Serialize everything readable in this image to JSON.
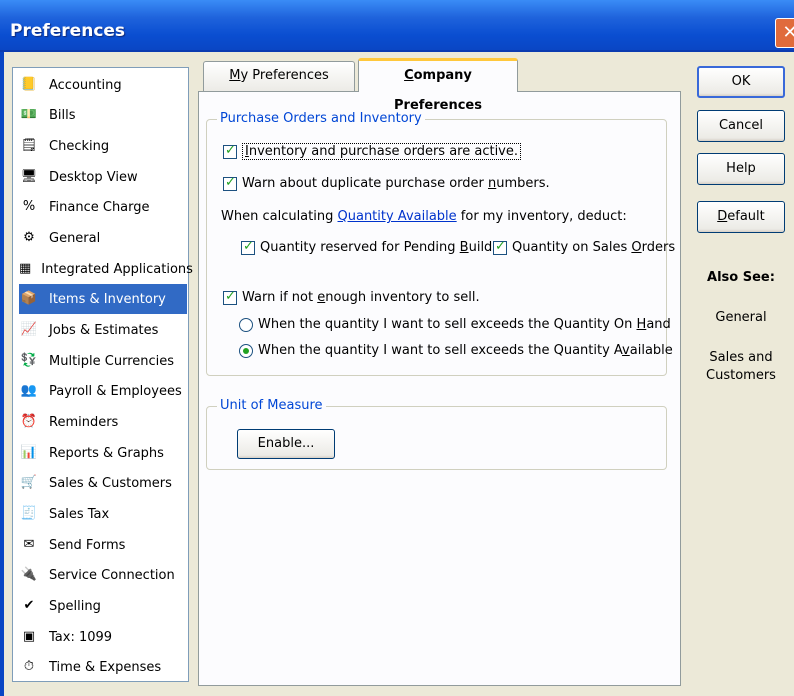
{
  "window": {
    "title": "Preferences",
    "close_symbol": "✕"
  },
  "categories": [
    {
      "label": "Accounting",
      "icon": "accounting-icon",
      "glyph": "📒"
    },
    {
      "label": "Bills",
      "icon": "bills-icon",
      "glyph": "💵"
    },
    {
      "label": "Checking",
      "icon": "checking-icon",
      "glyph": "🗒"
    },
    {
      "label": "Desktop View",
      "icon": "desktop-view-icon",
      "glyph": "🖥"
    },
    {
      "label": "Finance Charge",
      "icon": "finance-charge-icon",
      "glyph": "%"
    },
    {
      "label": "General",
      "icon": "general-icon",
      "glyph": "⚙"
    },
    {
      "label": "Integrated Applications",
      "icon": "integrated-applications-icon",
      "glyph": "▦"
    },
    {
      "label": "Items & Inventory",
      "icon": "items-inventory-icon",
      "glyph": "📦",
      "selected": true
    },
    {
      "label": "Jobs & Estimates",
      "icon": "jobs-estimates-icon",
      "glyph": "📈"
    },
    {
      "label": "Multiple Currencies",
      "icon": "multiple-currencies-icon",
      "glyph": "💱"
    },
    {
      "label": "Payroll & Employees",
      "icon": "payroll-employees-icon",
      "glyph": "👥"
    },
    {
      "label": "Reminders",
      "icon": "reminders-icon",
      "glyph": "⏰"
    },
    {
      "label": "Reports & Graphs",
      "icon": "reports-graphs-icon",
      "glyph": "📊"
    },
    {
      "label": "Sales & Customers",
      "icon": "sales-customers-icon",
      "glyph": "🛒"
    },
    {
      "label": "Sales Tax",
      "icon": "sales-tax-icon",
      "glyph": "🧾"
    },
    {
      "label": "Send Forms",
      "icon": "send-forms-icon",
      "glyph": "✉"
    },
    {
      "label": "Service Connection",
      "icon": "service-connection-icon",
      "glyph": "🔌"
    },
    {
      "label": "Spelling",
      "icon": "spelling-icon",
      "glyph": "✔"
    },
    {
      "label": "Tax: 1099",
      "icon": "tax-1099-icon",
      "glyph": "▣"
    },
    {
      "label": "Time & Expenses",
      "icon": "time-expenses-icon",
      "glyph": "⏱"
    }
  ],
  "tabs": {
    "my_label_first": "M",
    "my_label_rest": "y Preferences",
    "company_label_first": "C",
    "company_label_rest": "ompany Preferences"
  },
  "purchase": {
    "legend": "Purchase Orders and Inventory",
    "inventory_active": {
      "first": "I",
      "rest": "nventory and purchase orders are active.",
      "checked": true
    },
    "warn_duplicate": {
      "pre": "Warn about duplicate purchase order ",
      "acc": "n",
      "post": "umbers.",
      "checked": true
    },
    "calc_pre": "When calculating ",
    "calc_link": "Quantity Available",
    "calc_post": " for my inventory, deduct:",
    "pending_builds": {
      "pre": "Quantity reserved for Pending ",
      "acc": "B",
      "post": "uilds",
      "checked": true
    },
    "sales_orders": {
      "pre": "Quantity on Sales ",
      "acc": "O",
      "post": "rders",
      "checked": true
    },
    "warn_not_enough": {
      "pre": "Warn if not ",
      "acc": "e",
      "post": "nough inventory to sell.",
      "checked": true
    },
    "radio_on_hand": {
      "pre": "When the quantity I want to sell exceeds the Quantity On ",
      "acc": "H",
      "post": "and",
      "selected": false
    },
    "radio_available": {
      "pre": "When the quantity I want to sell exceeds the Quantity A",
      "acc": "v",
      "post": "ailable",
      "selected": true
    }
  },
  "unit_of_measure": {
    "legend": "Unit of Measure",
    "button": "Enable..."
  },
  "buttons": {
    "ok": "OK",
    "cancel": "Cancel",
    "help": "Help",
    "default_first": "D",
    "default_rest": "efault"
  },
  "also_see": {
    "heading": "Also See:",
    "links": [
      "General",
      "Sales and",
      "Customers"
    ]
  },
  "check_mark": "✓"
}
